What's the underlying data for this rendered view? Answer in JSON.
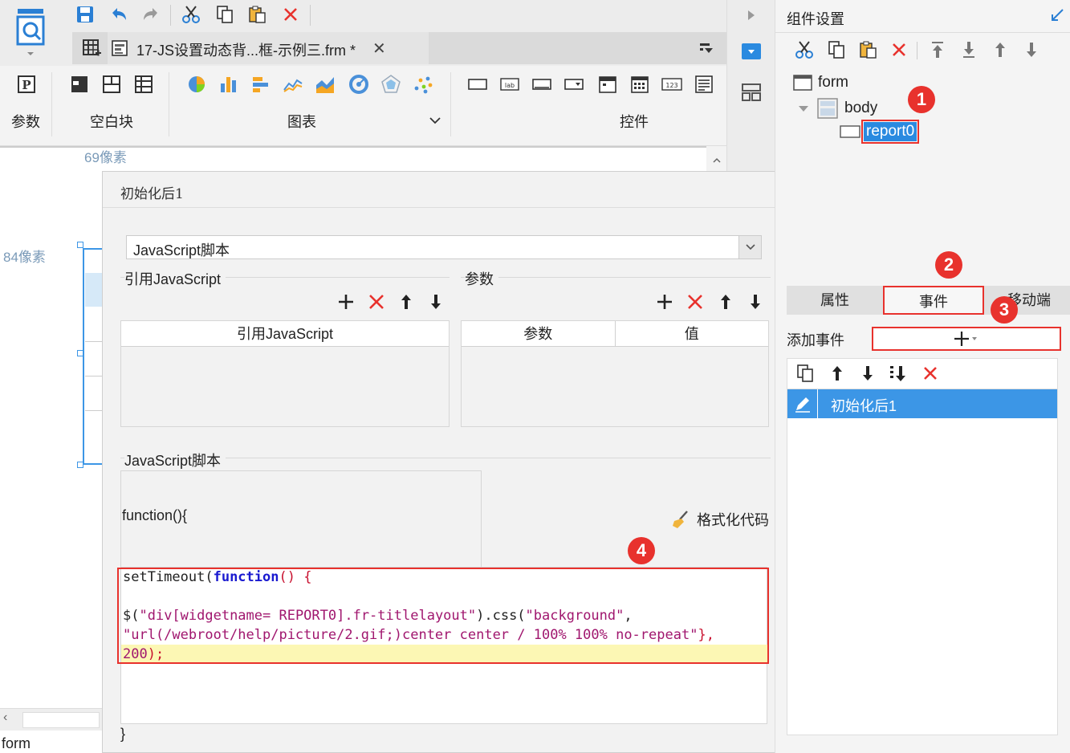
{
  "tab": {
    "title": "17-JS设置动态背...框-示例三.frm *"
  },
  "ribbon": {
    "groups": [
      "参数",
      "空白块",
      "图表",
      "控件"
    ]
  },
  "ruler": {
    "top_label": "69像素",
    "left_label": "84像素"
  },
  "canvas": {
    "footer_label": "form"
  },
  "dialog": {
    "title": "初始化后1",
    "type_select": "JavaScript脚本",
    "ref_js_section": "引用JavaScript",
    "params_section": "参数",
    "ref_js_col": "引用JavaScript",
    "param_col": "参数",
    "value_col": "值",
    "script_section": "JavaScript脚本",
    "func_open": "function(){",
    "format_code": "格式化代码",
    "code_line1_a": "setTimeout(",
    "code_line1_b": "function",
    "code_line1_c": "() {",
    "code_line3_a": "$(",
    "code_line3_b": "\"div[widgetname= REPORT0].fr-titlelayout\"",
    "code_line3_c": ").css(",
    "code_line3_d": "\"background\"",
    "code_line3_e": ",",
    "code_line4": "\"url(/webroot/help/picture/2.gif;)center center / 100% 100% no-repeat\"",
    "code_line4_end": "},",
    "code_line5": "200",
    "code_line5_end": ");",
    "func_close": "}"
  },
  "right": {
    "title": "组件设置",
    "tree": {
      "form": "form",
      "body": "body",
      "report": "report0"
    },
    "tabs": [
      "属性",
      "事件",
      "移动端"
    ],
    "add_event_label": "添加事件",
    "event_item": "初始化后1"
  },
  "badges": [
    "1",
    "2",
    "3",
    "4"
  ],
  "colors": {
    "accent": "#3c96e6",
    "highlight_red": "#e8322d",
    "selection": "#3c96e6"
  }
}
